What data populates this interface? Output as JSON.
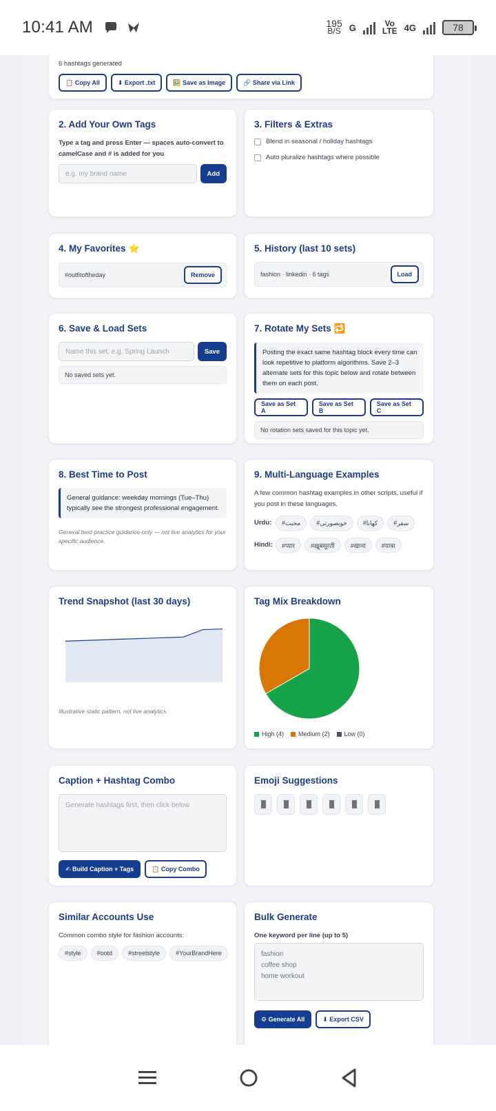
{
  "status_bar": {
    "time": "10:41 AM",
    "speed_value": "195",
    "speed_unit": "B/S",
    "net_g": "G",
    "volte_top": "Vo",
    "volte_bottom": "LTE",
    "net_4g": "4G",
    "battery": "78"
  },
  "top_card": {
    "count_text": "6 hashtags generated",
    "buttons": [
      "📋 Copy All",
      "⬇ Export .txt",
      "🖼️ Save as Image",
      "🔗 Share via Link"
    ]
  },
  "add_tags": {
    "title": "2. Add Your Own Tags",
    "help": "Type a tag and press Enter — spaces auto-convert to camelCase and # is added for you",
    "placeholder": "e.g. my brand name",
    "add_label": "Add"
  },
  "filters": {
    "title": "3. Filters & Extras",
    "options": [
      "Blend in seasonal / holiday hashtags",
      "Auto pluralize hashtags where possible"
    ]
  },
  "favorites": {
    "title": "4. My Favorites ⭐",
    "item": "#outfitoftheday",
    "remove_label": "Remove"
  },
  "history": {
    "title": "5. History (last 10 sets)",
    "item": "fashion · linkedin · 6 tags",
    "load_label": "Load"
  },
  "save_sets": {
    "title": "6. Save & Load Sets",
    "placeholder": "Name this set, e.g. Spring Launch",
    "save_label": "Save",
    "empty": "No saved sets yet."
  },
  "rotate": {
    "title": "7. Rotate My Sets 🔁",
    "note": "Posting the exact same hashtag block every time can look repetitive to platform algorithms. Save 2–3 alternate sets for this topic below and rotate between them on each post.",
    "buttons": [
      "Save as Set A",
      "Save as Set B",
      "Save as Set C"
    ],
    "empty": "No rotation sets saved for this topic yet."
  },
  "best_time": {
    "title": "8. Best Time to Post",
    "note": "General guidance: weekday mornings (Tue–Thu) typically see the strongest professional engagement.",
    "disclaimer": "General best-practice guidance only — not live analytics for your specific audience."
  },
  "multi_lang": {
    "title": "9. Multi-Language Examples",
    "desc": "A few common hashtag examples in other scripts, useful if you post in these languages.",
    "urdu_label": "Urdu:",
    "urdu_tags": [
      "#محبت",
      "#خوبصورتی",
      "#کھانا",
      "#سفر"
    ],
    "hindi_label": "Hindi:",
    "hindi_tags": [
      "#प्यार",
      "#ख़ूबसूरती",
      "#खाना",
      "#यात्रा"
    ]
  },
  "trend": {
    "title": "Trend Snapshot (last 30 days)",
    "disclaimer": "Illustrative static pattern, not live analytics."
  },
  "chart_data": [
    {
      "type": "area",
      "title": "Trend Snapshot (last 30 days)",
      "x": [
        0,
        1,
        2,
        3,
        4,
        5,
        6,
        7,
        8
      ],
      "values": [
        61,
        62,
        63,
        64,
        65,
        66,
        67,
        78,
        79
      ],
      "ylim": [
        0,
        100
      ],
      "grid": false,
      "colors": {
        "fill": "#e2e8f3",
        "line": "#1e3a8a"
      }
    },
    {
      "type": "pie",
      "title": "Tag Mix Breakdown",
      "labels": [
        "High",
        "Medium",
        "Low"
      ],
      "values": [
        4,
        2,
        0
      ],
      "legend": [
        "High (4)",
        "Medium (2)",
        "Low (0)"
      ],
      "colors": [
        "#16a34a",
        "#d97706",
        "#4b5563"
      ],
      "legend_position": "bottom"
    }
  ],
  "tag_mix": {
    "title": "Tag Mix Breakdown"
  },
  "caption": {
    "title": "Caption + Hashtag Combo",
    "placeholder": "Generate hashtags first, then click below",
    "build_label": "✍ Build Caption + Tags",
    "copy_label": "📋 Copy Combo"
  },
  "emoji": {
    "title": "Emoji Suggestions",
    "count": 6
  },
  "similar": {
    "title": "Similar Accounts Use",
    "desc": "Common combo style for fashion accounts:",
    "tags": [
      "#style",
      "#ootd",
      "#streetstyle",
      "#YourBrandHere"
    ]
  },
  "bulk": {
    "title": "Bulk Generate",
    "label": "One keyword per line (up to 5)",
    "lines": [
      "fashion",
      "coffee shop",
      "home workout"
    ],
    "generate_label": "⚙ Generate All",
    "export_label": "⬇ Export CSV"
  }
}
